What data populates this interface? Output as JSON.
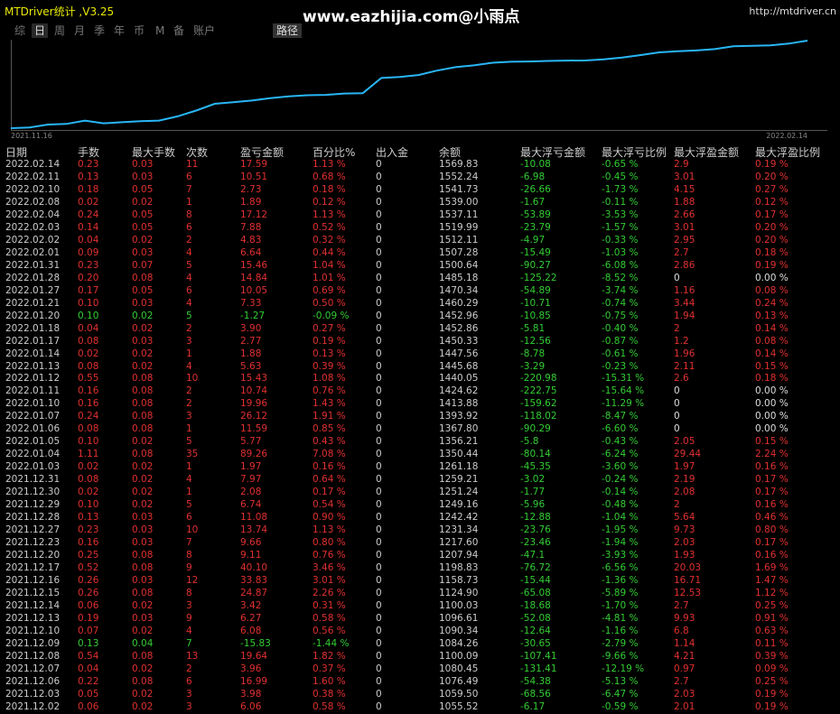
{
  "app": {
    "title": "MTDriver统计 ,V3.25",
    "watermark": "www.eazhijia.com@小雨点",
    "url": "http://mtdriver.cn"
  },
  "tabs": [
    "综",
    "日",
    "周",
    "月",
    "季",
    "年",
    "币",
    "M",
    "备",
    "账户"
  ],
  "active_tab": "日",
  "path_button": "路径",
  "chart": {
    "start_date": "2021.11.16",
    "end_date": "2022.02.14",
    "line_color": "#29b6f6",
    "balance_series": [
      1055.52,
      1059.5,
      1076.49,
      1080.45,
      1100.09,
      1084.26,
      1090.34,
      1096.61,
      1100.03,
      1124.9,
      1158.73,
      1198.83,
      1207.94,
      1217.6,
      1231.34,
      1242.42,
      1249.16,
      1251.24,
      1259.21,
      1261.18,
      1350.44,
      1356.21,
      1367.8,
      1393.92,
      1413.88,
      1424.62,
      1440.05,
      1445.68,
      1447.56,
      1450.33,
      1452.86,
      1452.96,
      1460.29,
      1470.34,
      1485.18,
      1500.64,
      1507.28,
      1512.11,
      1519.99,
      1537.11,
      1539.0,
      1541.73,
      1552.24,
      1569.83
    ]
  },
  "table": {
    "headers": [
      "日期",
      "手数",
      "最大手数",
      "次数",
      "盈亏金额",
      "百分比%",
      "出入金",
      "余额",
      "最大浮亏金额",
      "最大浮亏比例",
      "最大浮盈金额",
      "最大浮盈比例"
    ],
    "rows": [
      [
        "2022.02.14",
        "0.23",
        "0.03",
        "11",
        "17.59",
        "1.13 %",
        "0",
        "1569.83",
        "-10.08",
        "-0.65 %",
        "2.9",
        "0.19 %"
      ],
      [
        "2022.02.11",
        "0.13",
        "0.03",
        "6",
        "10.51",
        "0.68 %",
        "0",
        "1552.24",
        "-6.98",
        "-0.45 %",
        "3.01",
        "0.20 %"
      ],
      [
        "2022.02.10",
        "0.18",
        "0.05",
        "7",
        "2.73",
        "0.18 %",
        "0",
        "1541.73",
        "-26.66",
        "-1.73 %",
        "4.15",
        "0.27 %"
      ],
      [
        "2022.02.08",
        "0.02",
        "0.02",
        "1",
        "1.89",
        "0.12 %",
        "0",
        "1539.00",
        "-1.67",
        "-0.11 %",
        "1.88",
        "0.12 %"
      ],
      [
        "2022.02.04",
        "0.24",
        "0.05",
        "8",
        "17.12",
        "1.13 %",
        "0",
        "1537.11",
        "-53.89",
        "-3.53 %",
        "2.66",
        "0.17 %"
      ],
      [
        "2022.02.03",
        "0.14",
        "0.05",
        "6",
        "7.88",
        "0.52 %",
        "0",
        "1519.99",
        "-23.79",
        "-1.57 %",
        "3.01",
        "0.20 %"
      ],
      [
        "2022.02.02",
        "0.04",
        "0.02",
        "2",
        "4.83",
        "0.32 %",
        "0",
        "1512.11",
        "-4.97",
        "-0.33 %",
        "2.95",
        "0.20 %"
      ],
      [
        "2022.02.01",
        "0.09",
        "0.03",
        "4",
        "6.64",
        "0.44 %",
        "0",
        "1507.28",
        "-15.49",
        "-1.03 %",
        "2.7",
        "0.18 %"
      ],
      [
        "2022.01.31",
        "0.23",
        "0.07",
        "5",
        "15.46",
        "1.04 %",
        "0",
        "1500.64",
        "-90.27",
        "-6.08 %",
        "2.86",
        "0.19 %"
      ],
      [
        "2022.01.28",
        "0.20",
        "0.08",
        "4",
        "14.84",
        "1.01 %",
        "0",
        "1485.18",
        "-125.22",
        "-8.52 %",
        "0",
        "0.00 %"
      ],
      [
        "2022.01.27",
        "0.17",
        "0.05",
        "6",
        "10.05",
        "0.69 %",
        "0",
        "1470.34",
        "-54.89",
        "-3.74 %",
        "1.16",
        "0.08 %"
      ],
      [
        "2022.01.21",
        "0.10",
        "0.03",
        "4",
        "7.33",
        "0.50 %",
        "0",
        "1460.29",
        "-10.71",
        "-0.74 %",
        "3.44",
        "0.24 %"
      ],
      [
        "2022.01.20",
        "0.10",
        "0.02",
        "5",
        "-1.27",
        "-0.09 %",
        "0",
        "1452.96",
        "-10.85",
        "-0.75 %",
        "1.94",
        "0.13 %"
      ],
      [
        "2022.01.18",
        "0.04",
        "0.02",
        "2",
        "3.90",
        "0.27 %",
        "0",
        "1452.86",
        "-5.81",
        "-0.40 %",
        "2",
        "0.14 %"
      ],
      [
        "2022.01.17",
        "0.08",
        "0.03",
        "3",
        "2.77",
        "0.19 %",
        "0",
        "1450.33",
        "-12.56",
        "-0.87 %",
        "1.2",
        "0.08 %"
      ],
      [
        "2022.01.14",
        "0.02",
        "0.02",
        "1",
        "1.88",
        "0.13 %",
        "0",
        "1447.56",
        "-8.78",
        "-0.61 %",
        "1.96",
        "0.14 %"
      ],
      [
        "2022.01.13",
        "0.08",
        "0.02",
        "4",
        "5.63",
        "0.39 %",
        "0",
        "1445.68",
        "-3.29",
        "-0.23 %",
        "2.11",
        "0.15 %"
      ],
      [
        "2022.01.12",
        "0.55",
        "0.08",
        "10",
        "15.43",
        "1.08 %",
        "0",
        "1440.05",
        "-220.98",
        "-15.31 %",
        "2.6",
        "0.18 %"
      ],
      [
        "2022.01.11",
        "0.16",
        "0.08",
        "2",
        "10.74",
        "0.76 %",
        "0",
        "1424.62",
        "-222.75",
        "-15.64 %",
        "0",
        "0.00 %"
      ],
      [
        "2022.01.10",
        "0.16",
        "0.08",
        "2",
        "19.96",
        "1.43 %",
        "0",
        "1413.88",
        "-159.62",
        "-11.29 %",
        "0",
        "0.00 %"
      ],
      [
        "2022.01.07",
        "0.24",
        "0.08",
        "3",
        "26.12",
        "1.91 %",
        "0",
        "1393.92",
        "-118.02",
        "-8.47 %",
        "0",
        "0.00 %"
      ],
      [
        "2022.01.06",
        "0.08",
        "0.08",
        "1",
        "11.59",
        "0.85 %",
        "0",
        "1367.80",
        "-90.29",
        "-6.60 %",
        "0",
        "0.00 %"
      ],
      [
        "2022.01.05",
        "0.10",
        "0.02",
        "5",
        "5.77",
        "0.43 %",
        "0",
        "1356.21",
        "-5.8",
        "-0.43 %",
        "2.05",
        "0.15 %"
      ],
      [
        "2022.01.04",
        "1.11",
        "0.08",
        "35",
        "89.26",
        "7.08 %",
        "0",
        "1350.44",
        "-80.14",
        "-6.24 %",
        "29.44",
        "2.24 %"
      ],
      [
        "2022.01.03",
        "0.02",
        "0.02",
        "1",
        "1.97",
        "0.16 %",
        "0",
        "1261.18",
        "-45.35",
        "-3.60 %",
        "1.97",
        "0.16 %"
      ],
      [
        "2021.12.31",
        "0.08",
        "0.02",
        "4",
        "7.97",
        "0.64 %",
        "0",
        "1259.21",
        "-3.02",
        "-0.24 %",
        "2.19",
        "0.17 %"
      ],
      [
        "2021.12.30",
        "0.02",
        "0.02",
        "1",
        "2.08",
        "0.17 %",
        "0",
        "1251.24",
        "-1.77",
        "-0.14 %",
        "2.08",
        "0.17 %"
      ],
      [
        "2021.12.29",
        "0.10",
        "0.02",
        "5",
        "6.74",
        "0.54 %",
        "0",
        "1249.16",
        "-5.96",
        "-0.48 %",
        "2",
        "0.16 %"
      ],
      [
        "2021.12.28",
        "0.13",
        "0.03",
        "6",
        "11.08",
        "0.90 %",
        "0",
        "1242.42",
        "-12.88",
        "-1.04 %",
        "5.64",
        "0.46 %"
      ],
      [
        "2021.12.27",
        "0.23",
        "0.03",
        "10",
        "13.74",
        "1.13 %",
        "0",
        "1231.34",
        "-23.76",
        "-1.95 %",
        "9.73",
        "0.80 %"
      ],
      [
        "2021.12.23",
        "0.16",
        "0.03",
        "7",
        "9.66",
        "0.80 %",
        "0",
        "1217.60",
        "-23.46",
        "-1.94 %",
        "2.03",
        "0.17 %"
      ],
      [
        "2021.12.20",
        "0.25",
        "0.08",
        "8",
        "9.11",
        "0.76 %",
        "0",
        "1207.94",
        "-47.1",
        "-3.93 %",
        "1.93",
        "0.16 %"
      ],
      [
        "2021.12.17",
        "0.52",
        "0.08",
        "9",
        "40.10",
        "3.46 %",
        "0",
        "1198.83",
        "-76.72",
        "-6.56 %",
        "20.03",
        "1.69 %"
      ],
      [
        "2021.12.16",
        "0.26",
        "0.03",
        "12",
        "33.83",
        "3.01 %",
        "0",
        "1158.73",
        "-15.44",
        "-1.36 %",
        "16.71",
        "1.47 %"
      ],
      [
        "2021.12.15",
        "0.26",
        "0.08",
        "8",
        "24.87",
        "2.26 %",
        "0",
        "1124.90",
        "-65.08",
        "-5.89 %",
        "12.53",
        "1.12 %"
      ],
      [
        "2021.12.14",
        "0.06",
        "0.02",
        "3",
        "3.42",
        "0.31 %",
        "0",
        "1100.03",
        "-18.68",
        "-1.70 %",
        "2.7",
        "0.25 %"
      ],
      [
        "2021.12.13",
        "0.19",
        "0.03",
        "9",
        "6.27",
        "0.58 %",
        "0",
        "1096.61",
        "-52.08",
        "-4.81 %",
        "9.93",
        "0.91 %"
      ],
      [
        "2021.12.10",
        "0.07",
        "0.02",
        "4",
        "6.08",
        "0.56 %",
        "0",
        "1090.34",
        "-12.64",
        "-1.16 %",
        "6.8",
        "0.63 %"
      ],
      [
        "2021.12.09",
        "0.13",
        "0.04",
        "7",
        "-15.83",
        "-1.44 %",
        "0",
        "1084.26",
        "-30.65",
        "-2.79 %",
        "1.14",
        "0.11 %"
      ],
      [
        "2021.12.08",
        "0.54",
        "0.08",
        "13",
        "19.64",
        "1.82 %",
        "0",
        "1100.09",
        "-107.41",
        "-9.66 %",
        "4.21",
        "0.39 %"
      ],
      [
        "2021.12.07",
        "0.04",
        "0.02",
        "2",
        "3.96",
        "0.37 %",
        "0",
        "1080.45",
        "-131.41",
        "-12.19 %",
        "0.97",
        "0.09 %"
      ],
      [
        "2021.12.06",
        "0.22",
        "0.08",
        "6",
        "16.99",
        "1.60 %",
        "0",
        "1076.49",
        "-54.38",
        "-5.13 %",
        "2.7",
        "0.25 %"
      ],
      [
        "2021.12.03",
        "0.05",
        "0.02",
        "3",
        "3.98",
        "0.38 %",
        "0",
        "1059.50",
        "-68.56",
        "-6.47 %",
        "2.03",
        "0.19 %"
      ],
      [
        "2021.12.02",
        "0.06",
        "0.02",
        "3",
        "6.06",
        "0.58 %",
        "0",
        "1055.52",
        "-6.17",
        "-0.59 %",
        "2.01",
        "0.19 %"
      ]
    ]
  }
}
